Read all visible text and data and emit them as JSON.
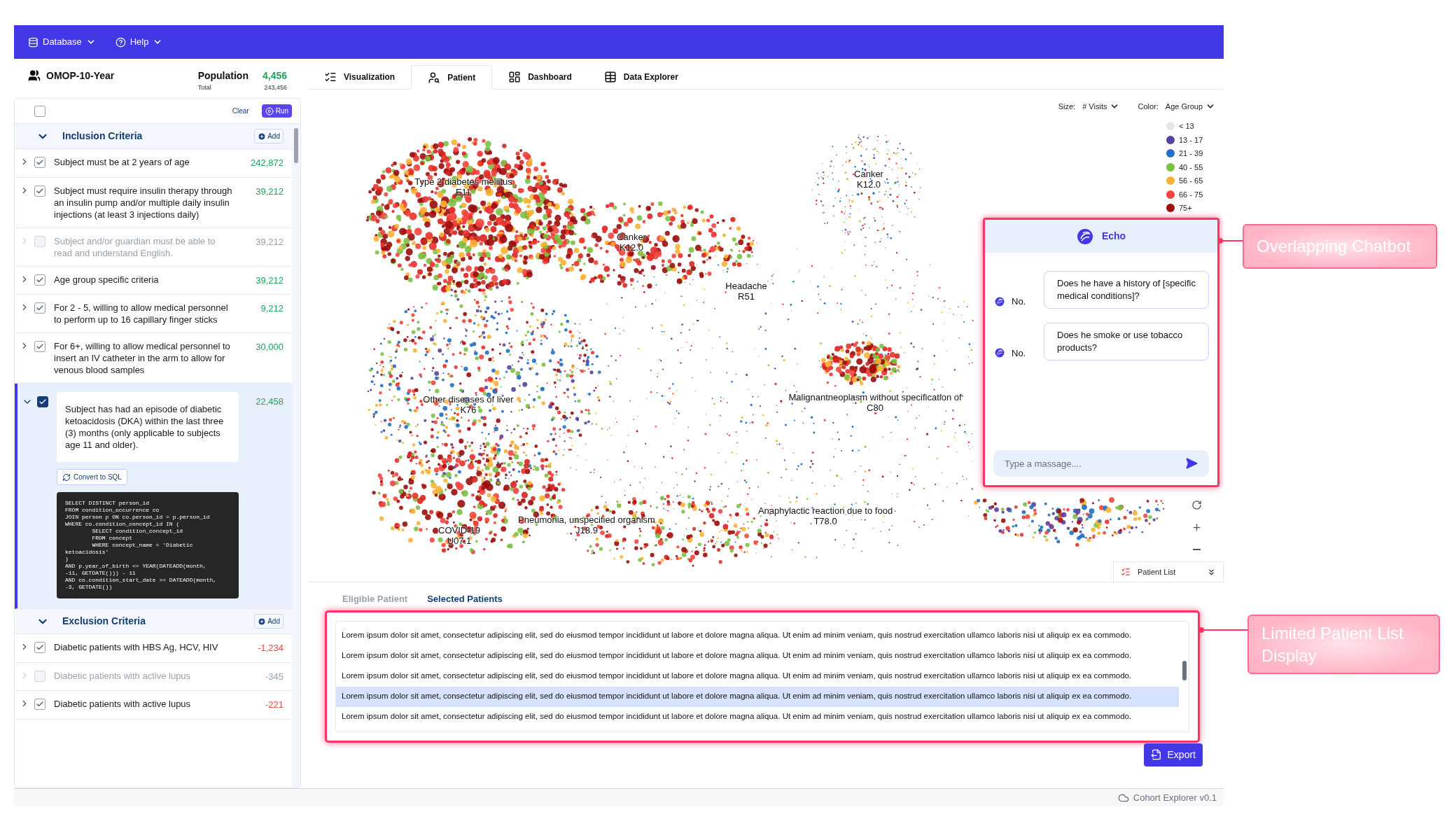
{
  "menu": [
    {
      "label": "Database"
    },
    {
      "label": "Help"
    }
  ],
  "dataset": {
    "name": "OMOP-10-Year",
    "population_label": "Population",
    "population": "4,456",
    "total_label": "Total",
    "total": "243,456"
  },
  "toolbar": {
    "all_checked": false,
    "clear": "Clear",
    "run": "Run"
  },
  "groups": [
    {
      "title": "Inclusion Criteria",
      "kind": "inclusion",
      "expanded": true,
      "add": "Add",
      "criteria": [
        {
          "text": "Subject must be at 2 years of age",
          "count": "242,872",
          "checked": true,
          "disabled": false,
          "expanded": false
        },
        {
          "text": "Subject must require insulin therapy through an insulin pump and/or multiple daily insulin injections (at least 3 injections daily)",
          "count": "39,212",
          "checked": true,
          "disabled": false,
          "expanded": false
        },
        {
          "text": "Subject and/or guardian must be able to read and understand English.",
          "count": "39,212",
          "checked": false,
          "disabled": true,
          "expanded": false
        },
        {
          "text": "Age group specific criteria",
          "count": "39,212",
          "checked": true,
          "disabled": false,
          "expanded": false
        },
        {
          "text": "For 2 - 5, willing to allow medical personnel to perform up to 16 capillary finger sticks",
          "count": "9,212",
          "checked": true,
          "disabled": false,
          "expanded": false
        },
        {
          "text": "For 6+, willing to allow medical personnel to insert an IV catheter in the arm to allow for venous blood samples",
          "count": "30,000",
          "checked": true,
          "disabled": false,
          "expanded": false
        },
        {
          "text": "Subject has had an episode of diabetic ketoacidosis (DKA) within the last three (3) months (only applicable to subjects age 11 and older).",
          "count": "22,458",
          "checked": true,
          "disabled": false,
          "expanded": true,
          "convert": "Convert to SQL",
          "sql": "SELECT DISTINCT person_id\nFROM condition_occurrence co\nJOIN person p ON co.person_id = p.person_id\nWHERE co.condition_concept_id IN (\n        SELECT condition_concept_id\n        FROM concept\n        WHERE concept_name = 'Diabetic\nketoacidosis'\n)\nAND p.year_of_birth <= YEAR(DATEADD(month,\n-11, GETDATE())) - 11\nAND co.condition_start_date >= DATEADD(month,\n-3, GETDATE())"
        }
      ]
    },
    {
      "title": "Exclusion Criteria",
      "kind": "exclusion",
      "expanded": true,
      "add": "Add",
      "criteria": [
        {
          "text": "Diabetic patients with HBS Ag, HCV, HIV",
          "count": "-1,234",
          "checked": true,
          "disabled": false,
          "expanded": false
        },
        {
          "text": "Diabetic patients with active lupus",
          "count": "-345",
          "checked": false,
          "disabled": true,
          "expanded": false
        },
        {
          "text": "Diabetic patients with active lupus",
          "count": "-221",
          "checked": true,
          "disabled": false,
          "expanded": false
        }
      ]
    }
  ],
  "tabs": [
    {
      "label": "Visualization",
      "selected": false
    },
    {
      "label": "Patient",
      "selected": true
    },
    {
      "label": "Dashboard",
      "selected": false
    },
    {
      "label": "Data Explorer",
      "selected": false
    }
  ],
  "plot": {
    "size": {
      "label": "Size:",
      "value": "# Visits"
    },
    "color": {
      "label": "Color:",
      "value": "Age Group"
    },
    "legend": [
      {
        "label": "< 13",
        "color": "#e6e6e6"
      },
      {
        "label": "13 - 17",
        "color": "#5b3f9e"
      },
      {
        "label": "21 - 39",
        "color": "#1f6fc5"
      },
      {
        "label": "40 - 55",
        "color": "#7ac143"
      },
      {
        "label": "56 - 65",
        "color": "#f9b233"
      },
      {
        "label": "66 - 75",
        "color": "#f2453d"
      },
      {
        "label": "75+",
        "color": "#9b0d0d"
      }
    ],
    "clusters": [
      {
        "name": "Type 2 diabetes mellitus",
        "code": "E11"
      },
      {
        "name": "Canker",
        "code": "K12.0"
      },
      {
        "name": "Canker",
        "code": "K12.0"
      },
      {
        "name": "Headache",
        "code": "R51"
      },
      {
        "name": "Other diseases of liver",
        "code": "K76"
      },
      {
        "name": "Malignantneoplasm without specification of",
        "code": "C80"
      },
      {
        "name": "COVID-19",
        "code": "U07.1"
      },
      {
        "name": "Pneumonia, unspecified organism",
        "code": "J18.9"
      },
      {
        "name": "Anaphylactic reaction due to food",
        "code": "T78.0"
      }
    ],
    "patient_list_tab": "Patient List"
  },
  "chat": {
    "title": "Echo",
    "messages": [
      {
        "kind": "user",
        "text": "Does he have a history of [specific medical conditions]?"
      },
      {
        "kind": "bot",
        "text": "No."
      },
      {
        "kind": "user",
        "text": "Does he smoke or use tobacco products?"
      },
      {
        "kind": "bot",
        "text": "No."
      }
    ],
    "placeholder": "Type a massage...."
  },
  "patients": {
    "tabs": [
      {
        "label": "Eligible Patient",
        "selected": false
      },
      {
        "label": "Selected Patients",
        "selected": true
      }
    ],
    "rows": [
      {
        "text": "Lorem ipsum dolor sit amet, consectetur adipiscing elit, sed do eiusmod tempor incididunt ut labore et dolore magna aliqua. Ut enim ad minim veniam, quis nostrud exercitation ullamco laboris nisi ut aliquip ex ea commodo.",
        "selected": false
      },
      {
        "text": "Lorem ipsum dolor sit amet, consectetur adipiscing elit, sed do eiusmod tempor incididunt ut labore et dolore magna aliqua. Ut enim ad minim veniam, quis nostrud exercitation ullamco laboris nisi ut aliquip ex ea commodo.",
        "selected": false
      },
      {
        "text": "Lorem ipsum dolor sit amet, consectetur adipiscing elit, sed do eiusmod tempor incididunt ut labore et dolore magna aliqua. Ut enim ad minim veniam, quis nostrud exercitation ullamco laboris nisi ut aliquip ex ea commodo.",
        "selected": false
      },
      {
        "text": "Lorem ipsum dolor sit amet, consectetur adipiscing elit, sed do eiusmod tempor incididunt ut labore et dolore magna aliqua. Ut enim ad minim veniam, quis nostrud exercitation ullamco laboris nisi ut aliquip ex ea commodo.",
        "selected": true
      },
      {
        "text": "Lorem ipsum dolor sit amet, consectetur adipiscing elit, sed do eiusmod tempor incididunt ut labore et dolore magna aliqua. Ut enim ad minim veniam, quis nostrud exercitation ullamco laboris nisi ut aliquip ex ea commodo.",
        "selected": false
      }
    ],
    "export": "Export"
  },
  "footer": "Cohort Explorer v0.1",
  "annotations": [
    {
      "text": "Overlapping Chatbot"
    },
    {
      "text": "Limited Patient List Display"
    }
  ]
}
